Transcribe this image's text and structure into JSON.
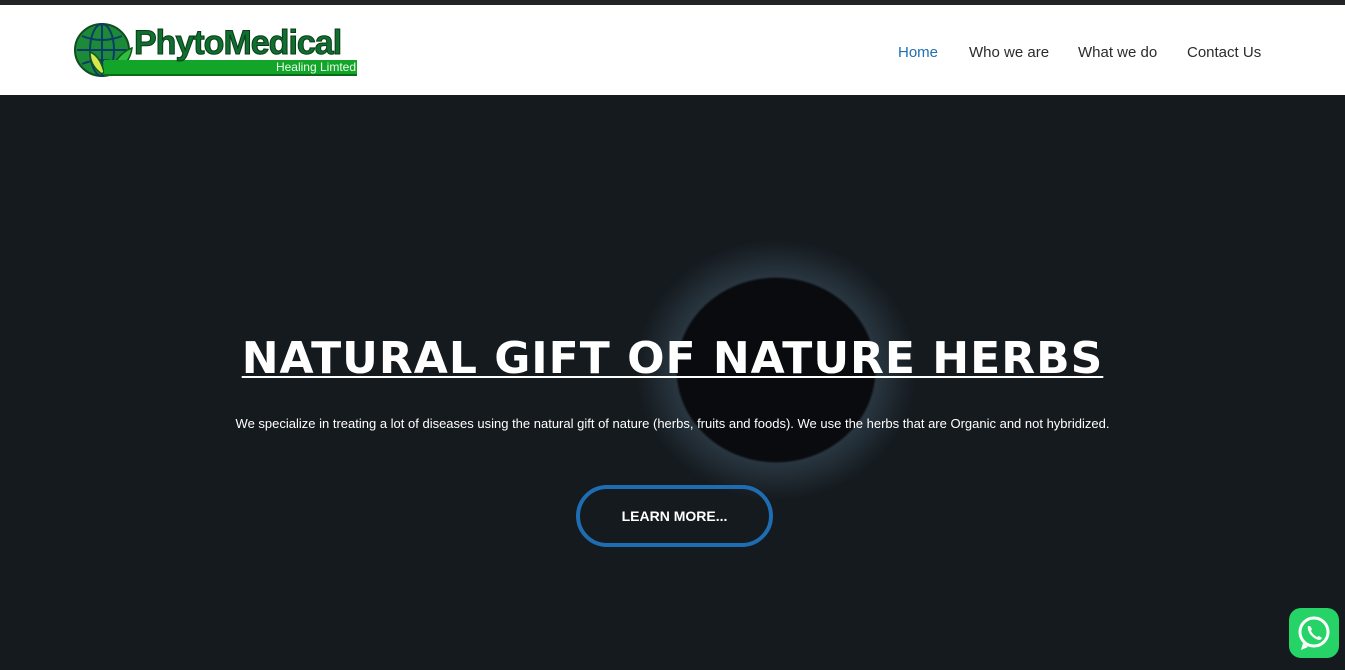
{
  "brand": {
    "name": "PhytoMedical",
    "tagline": "Healing Limted"
  },
  "nav": {
    "items": [
      {
        "label": "Home",
        "active": true
      },
      {
        "label": "Who we are",
        "active": false
      },
      {
        "label": "What we do",
        "active": false
      },
      {
        "label": "Contact Us",
        "active": false
      }
    ]
  },
  "hero": {
    "title": "NATURAL GIFT OF NATURE HERBS",
    "subtitle": "We specialize in treating a lot of diseases using the natural gift of nature (herbs, fruits and foods). We use the herbs that are Organic and not hybridized.",
    "button_label": "LEARN MORE..."
  },
  "colors": {
    "accent": "#1e6db3",
    "brand_green": "#13a52a",
    "whatsapp": "#25d366"
  },
  "icons": {
    "logo": "globe-leaf-icon",
    "chat": "whatsapp-icon"
  }
}
